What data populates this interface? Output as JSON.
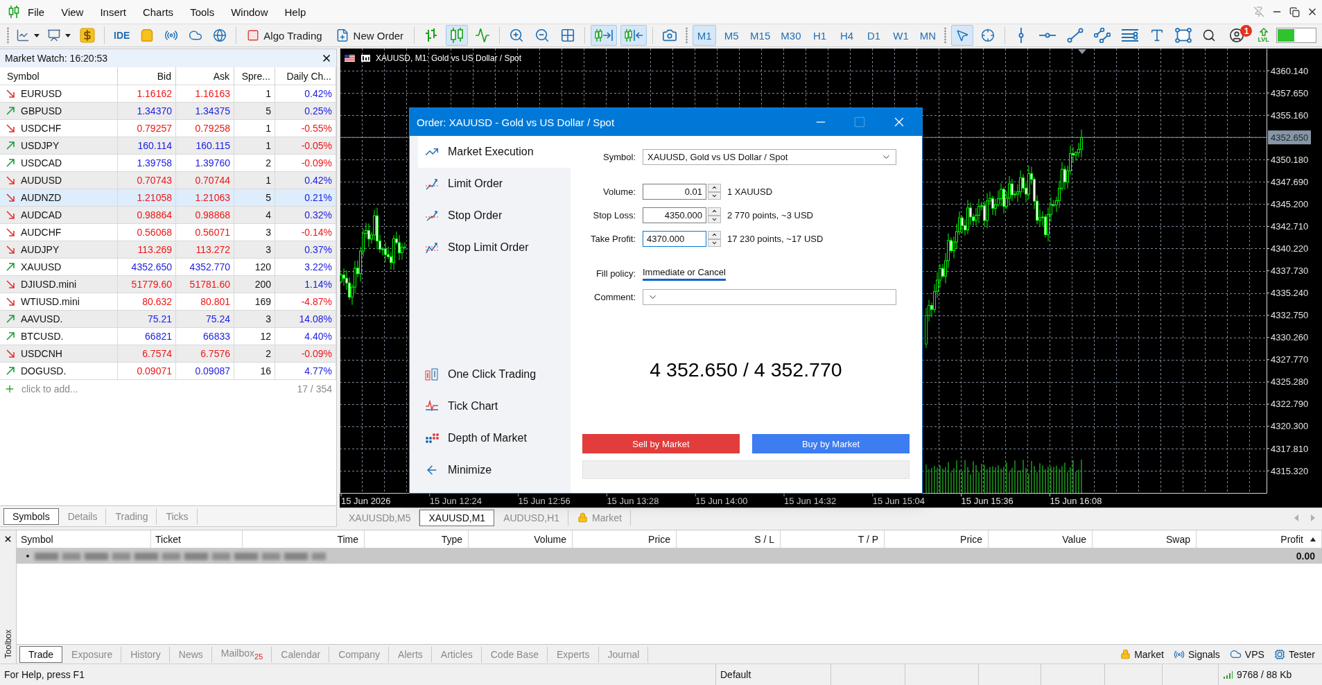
{
  "menu_bar": {
    "items": [
      "File",
      "View",
      "Insert",
      "Charts",
      "Tools",
      "Window",
      "Help"
    ]
  },
  "toolbar": {
    "ide_label": "IDE",
    "algo_trading": {
      "label": "Algo Trading",
      "on": false
    },
    "new_order_label": "New Order",
    "chart_types": [
      {
        "selected": false
      },
      {
        "selected": true
      },
      {
        "selected": false
      }
    ],
    "autoscroll": {
      "on": true
    },
    "chart_shift": {
      "on": true
    },
    "timeframes": [
      {
        "label": "M1",
        "selected": true
      },
      {
        "label": "M5",
        "selected": false
      },
      {
        "label": "M15",
        "selected": false
      },
      {
        "label": "M30",
        "selected": false
      },
      {
        "label": "H1",
        "selected": false
      },
      {
        "label": "H4",
        "selected": false
      },
      {
        "label": "D1",
        "selected": false
      },
      {
        "label": "W1",
        "selected": false
      },
      {
        "label": "MN",
        "selected": false
      }
    ],
    "pointer_tools": [
      {
        "selected": true
      },
      {
        "selected": false
      }
    ],
    "notification_badge": "1",
    "lvl_label": "LVL"
  },
  "market_watch": {
    "title": "Market Watch: 16:20:53",
    "columns": [
      "Symbol",
      "Bid",
      "Ask",
      "Spre...",
      "Daily Ch..."
    ],
    "rows": [
      {
        "symbol": "EURUSD",
        "trend_up": false,
        "bid": "1.16162",
        "bid_up": false,
        "ask": "1.16163",
        "ask_up": false,
        "spread": "1",
        "change": "0.42%",
        "change_up": true,
        "selected": false
      },
      {
        "symbol": "GBPUSD",
        "trend_up": true,
        "bid": "1.34370",
        "bid_up": true,
        "ask": "1.34375",
        "ask_up": true,
        "spread": "5",
        "change": "0.25%",
        "change_up": true,
        "selected": false
      },
      {
        "symbol": "USDCHF",
        "trend_up": false,
        "bid": "0.79257",
        "bid_up": false,
        "ask": "0.79258",
        "ask_up": false,
        "spread": "1",
        "change": "-0.55%",
        "change_up": false,
        "selected": false
      },
      {
        "symbol": "USDJPY",
        "trend_up": true,
        "bid": "160.114",
        "bid_up": true,
        "ask": "160.115",
        "ask_up": true,
        "spread": "1",
        "change": "-0.05%",
        "change_up": false,
        "selected": false
      },
      {
        "symbol": "USDCAD",
        "trend_up": true,
        "bid": "1.39758",
        "bid_up": true,
        "ask": "1.39760",
        "ask_up": true,
        "spread": "2",
        "change": "-0.09%",
        "change_up": false,
        "selected": false
      },
      {
        "symbol": "AUDUSD",
        "trend_up": false,
        "bid": "0.70743",
        "bid_up": false,
        "ask": "0.70744",
        "ask_up": false,
        "spread": "1",
        "change": "0.42%",
        "change_up": true,
        "selected": false
      },
      {
        "symbol": "AUDNZD",
        "trend_up": false,
        "bid": "1.21058",
        "bid_up": false,
        "ask": "1.21063",
        "ask_up": false,
        "spread": "5",
        "change": "0.21%",
        "change_up": true,
        "selected": true
      },
      {
        "symbol": "AUDCAD",
        "trend_up": false,
        "bid": "0.98864",
        "bid_up": false,
        "ask": "0.98868",
        "ask_up": false,
        "spread": "4",
        "change": "0.32%",
        "change_up": true,
        "selected": false
      },
      {
        "symbol": "AUDCHF",
        "trend_up": false,
        "bid": "0.56068",
        "bid_up": false,
        "ask": "0.56071",
        "ask_up": false,
        "spread": "3",
        "change": "-0.14%",
        "change_up": false,
        "selected": false
      },
      {
        "symbol": "AUDJPY",
        "trend_up": false,
        "bid": "113.269",
        "bid_up": false,
        "ask": "113.272",
        "ask_up": false,
        "spread": "3",
        "change": "0.37%",
        "change_up": true,
        "selected": false
      },
      {
        "symbol": "XAUUSD",
        "trend_up": true,
        "bid": "4352.650",
        "bid_up": true,
        "ask": "4352.770",
        "ask_up": true,
        "spread": "120",
        "change": "3.22%",
        "change_up": true,
        "selected": false
      },
      {
        "symbol": "DJIUSD.mini",
        "trend_up": false,
        "bid": "51779.60",
        "bid_up": false,
        "ask": "51781.60",
        "ask_up": false,
        "spread": "200",
        "change": "1.14%",
        "change_up": true,
        "selected": false
      },
      {
        "symbol": "WTIUSD.mini",
        "trend_up": false,
        "bid": "80.632",
        "bid_up": false,
        "ask": "80.801",
        "ask_up": false,
        "spread": "169",
        "change": "-4.87%",
        "change_up": false,
        "selected": false
      },
      {
        "symbol": "AAVUSD.",
        "trend_up": true,
        "bid": "75.21",
        "bid_up": true,
        "ask": "75.24",
        "ask_up": true,
        "spread": "3",
        "change": "14.08%",
        "change_up": true,
        "selected": false
      },
      {
        "symbol": "BTCUSD.",
        "trend_up": true,
        "bid": "66821",
        "bid_up": true,
        "ask": "66833",
        "ask_up": true,
        "spread": "12",
        "change": "4.40%",
        "change_up": true,
        "selected": false
      },
      {
        "symbol": "USDCNH",
        "trend_up": false,
        "bid": "6.7574",
        "bid_up": false,
        "ask": "6.7576",
        "ask_up": false,
        "spread": "2",
        "change": "-0.09%",
        "change_up": false,
        "selected": false
      },
      {
        "symbol": "DOGUSD.",
        "trend_up": true,
        "bid": "0.09071",
        "bid_up": false,
        "ask": "0.09087",
        "ask_up": true,
        "spread": "16",
        "change": "4.77%",
        "change_up": true,
        "selected": false
      }
    ],
    "add_label": "click to add...",
    "count": "17 / 354",
    "tabs": [
      {
        "label": "Symbols",
        "selected": true
      },
      {
        "label": "Details",
        "selected": false
      },
      {
        "label": "Trading",
        "selected": false
      },
      {
        "label": "Ticks",
        "selected": false
      }
    ]
  },
  "chart": {
    "title": "XAUUSD, M1: Gold vs US Dollar / Spot",
    "price_scale": [
      "4360.140",
      "4357.650",
      "4355.160",
      "4350.180",
      "4347.690",
      "4345.200",
      "4342.710",
      "4340.220",
      "4337.730",
      "4335.240",
      "4332.750",
      "4330.260",
      "4327.770",
      "4325.280",
      "4322.790",
      "4320.300",
      "4317.810",
      "4315.320"
    ],
    "current_price": "4352.650",
    "time_scale": [
      "15 Jun 2026",
      "15 Jun 12:24",
      "15 Jun 12:56",
      "15 Jun 13:28",
      "15 Jun 14:00",
      "15 Jun 14:32",
      "15 Jun 15:04",
      "15 Jun 15:36",
      "15 Jun 16:08"
    ]
  },
  "chart_tabs": [
    {
      "kind": "chart",
      "label": "XAUUSDb,M5",
      "selected": false
    },
    {
      "kind": "chart",
      "label": "XAUUSD,M1",
      "selected": true
    },
    {
      "kind": "chart",
      "label": "AUDUSD,H1",
      "selected": false
    },
    {
      "kind": "market",
      "label": "Market",
      "selected": false
    }
  ],
  "order_dialog": {
    "title": "Order: XAUUSD - Gold vs US Dollar / Spot",
    "maximize_enabled": false,
    "modes": [
      {
        "label": "Market Execution",
        "selected": true
      },
      {
        "label": "Limit Order",
        "selected": false
      },
      {
        "label": "Stop Order",
        "selected": false
      },
      {
        "label": "Stop Limit Order",
        "selected": false
      }
    ],
    "tools": [
      "One Click Trading",
      "Tick Chart",
      "Depth of Market",
      "Minimize"
    ],
    "field_groups": [
      [
        {
          "kind": "select",
          "label": "Symbol:",
          "value": "XAUUSD, Gold vs US Dollar / Spot"
        }
      ],
      [
        {
          "kind": "spin",
          "label": "Volume:",
          "value": "0.01",
          "note": "1 XAUUSD",
          "focused": false
        },
        {
          "kind": "spin",
          "label": "Stop Loss:",
          "value": "4350.000",
          "note": "2 770 points, ~3 USD",
          "focused": false
        },
        {
          "kind": "spin",
          "label": "Take Profit:",
          "value": "4370.000",
          "note": "17 230 points, ~17 USD",
          "focused": true
        }
      ],
      [
        {
          "kind": "link",
          "label": "Fill policy:",
          "value": "Immediate or Cancel"
        },
        {
          "kind": "select",
          "label": "Comment:"
        }
      ]
    ],
    "quote": "4 352.650 / 4 352.770",
    "sell_label": "Sell by Market",
    "buy_label": "Buy by Market"
  },
  "toolbox": {
    "title": "Toolbox",
    "columns": [
      {
        "label": "Symbol",
        "sorted": false
      },
      {
        "label": "Ticket",
        "sorted": false
      },
      {
        "label": "Time",
        "sorted": false
      },
      {
        "label": "Type",
        "sorted": false
      },
      {
        "label": "Volume",
        "sorted": false
      },
      {
        "label": "Price",
        "sorted": false
      },
      {
        "label": "S / L",
        "sorted": false
      },
      {
        "label": "T / P",
        "sorted": false
      },
      {
        "label": "Price",
        "sorted": false
      },
      {
        "label": "Value",
        "sorted": false
      },
      {
        "label": "Swap",
        "sorted": false
      },
      {
        "label": "Profit",
        "sorted": true
      }
    ],
    "balance_row": {
      "redacted": true,
      "profit": "0.00"
    },
    "tabs": [
      {
        "label": "Trade",
        "selected": true
      },
      {
        "label": "Exposure",
        "selected": false
      },
      {
        "label": "History",
        "selected": false
      },
      {
        "label": "News",
        "selected": false
      },
      {
        "label": "Mailbox$_{25}$",
        "selected": false
      },
      {
        "label": "Calendar",
        "selected": false
      },
      {
        "label": "Company",
        "selected": false
      },
      {
        "label": "Alerts",
        "selected": false
      },
      {
        "label": "Articles",
        "selected": false
      },
      {
        "label": "Code Base",
        "selected": false
      },
      {
        "label": "Experts",
        "selected": false
      },
      {
        "label": "Journal",
        "selected": false
      }
    ],
    "services": [
      "Market",
      "Signals",
      "VPS",
      "Tester"
    ]
  },
  "status_bar": {
    "help": "For Help, press F1",
    "profile": "Default",
    "traffic": "9768 / 88 Kb"
  }
}
